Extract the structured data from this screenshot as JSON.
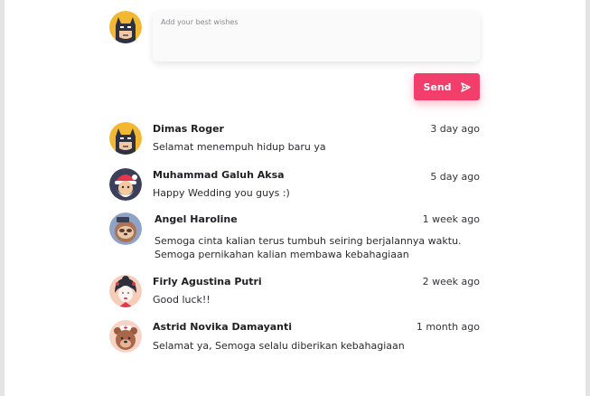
{
  "compose": {
    "placeholder": "Add your best wishes",
    "send_label": "Send"
  },
  "comments": [
    {
      "name": "Dimas Roger",
      "time": "3 day ago",
      "lines": [
        "Selamat menempuh hidup baru ya"
      ],
      "avatar": "batman-avatar-icon"
    },
    {
      "name": "Muhammad Galuh Aksa",
      "time": "5 day ago",
      "lines": [
        "Happy Wedding you guys :)"
      ],
      "avatar": "santa-avatar-icon"
    },
    {
      "name": "Angel Haroline",
      "time": "1 week ago",
      "lines": [
        "Semoga cinta kalian terus tumbuh seiring berjalannya waktu.",
        "Semoga pernikahan kalian membawa kebahagiaan"
      ],
      "avatar": "sloth-avatar-icon"
    },
    {
      "name": "Firly Agustina Putri",
      "time": "2 week ago",
      "lines": [
        "Good luck!!"
      ],
      "avatar": "geisha-avatar-icon"
    },
    {
      "name": "Astrid Novika Damayanti",
      "time": "1 month ago",
      "lines": [
        "Selamat ya, Semoga selalu diberikan kebahagiaan"
      ],
      "avatar": "bear-avatar-icon"
    }
  ],
  "colors": {
    "accent": "#f23e6a"
  }
}
